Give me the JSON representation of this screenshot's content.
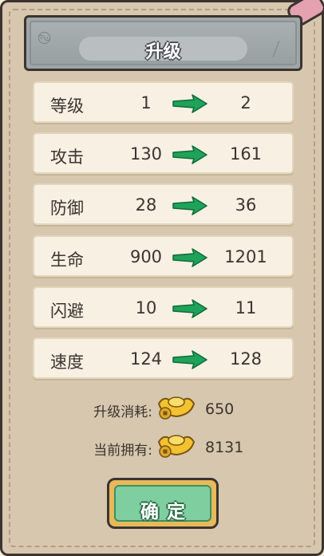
{
  "dialog": {
    "title": "升级"
  },
  "stats": [
    {
      "name": "等级",
      "current": "1",
      "next": "2"
    },
    {
      "name": "攻击",
      "current": "130",
      "next": "161"
    },
    {
      "name": "防御",
      "current": "28",
      "next": "36"
    },
    {
      "name": "生命",
      "current": "900",
      "next": "1201"
    },
    {
      "name": "闪避",
      "current": "10",
      "next": "11"
    },
    {
      "name": "速度",
      "current": "124",
      "next": "128"
    }
  ],
  "cost": {
    "label": "升级消耗:",
    "value": "650",
    "icon": "gold-ingot-icon"
  },
  "owned": {
    "label": "当前拥有:",
    "value": "8131",
    "icon": "gold-ingot-icon"
  },
  "confirm_button": {
    "label": "确定"
  },
  "colors": {
    "panel": "#d6c7ae",
    "row": "#f7f0e3",
    "arrow": "#1fa25a",
    "button_green": "#7fcea0",
    "button_gold": "#e8b95a"
  }
}
